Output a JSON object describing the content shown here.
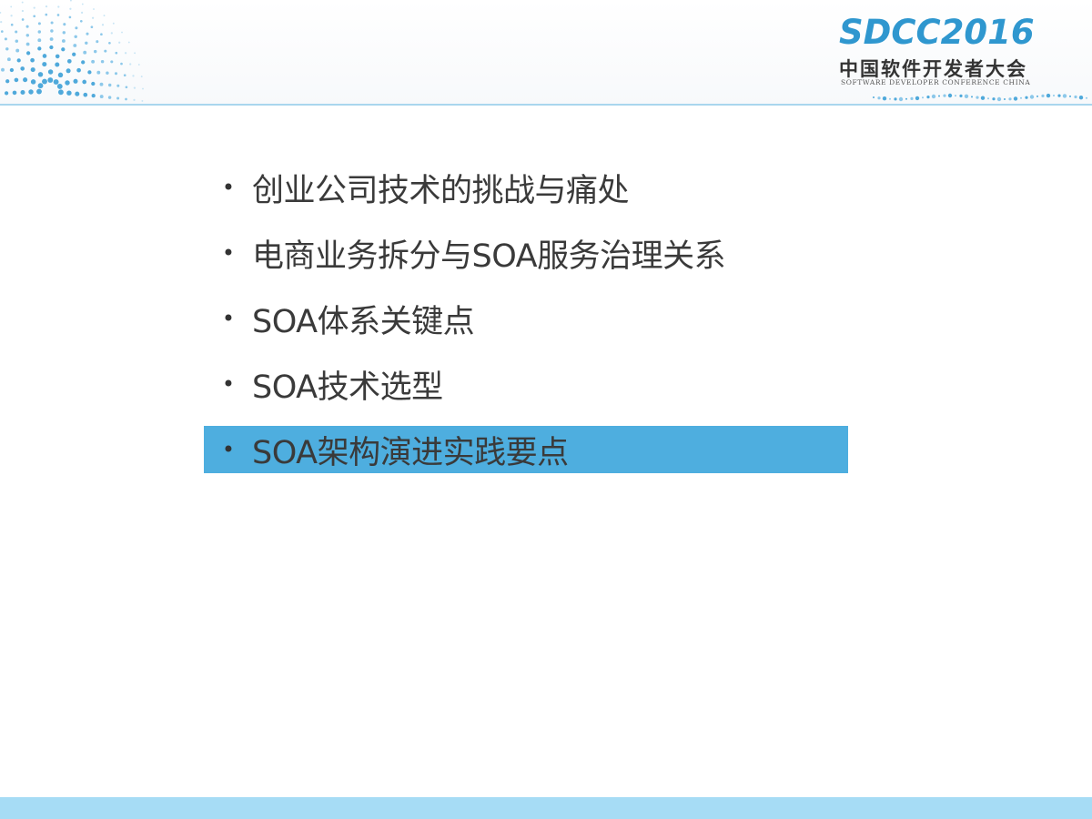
{
  "logo": {
    "title": "SDCC2016",
    "subtitle_cn": "中国软件开发者大会",
    "subtitle_en": "SOFTWARE DEVELOPER CONFERENCE CHINA"
  },
  "agenda": {
    "items": [
      {
        "label": "创业公司技术的挑战与痛处",
        "bullet": "•"
      },
      {
        "label": "电商业务拆分与SOA服务治理关系",
        "bullet": "•"
      },
      {
        "label": "SOA体系关键点",
        "bullet": "•"
      },
      {
        "label": "SOA技术选型",
        "bullet": "•"
      },
      {
        "label": "SOA架构演进实践要点",
        "bullet": "•",
        "highlighted": true
      }
    ]
  },
  "colors": {
    "brand_blue": "#2f97cf",
    "highlight": "#4eaedf",
    "footer": "#a6dcf5",
    "header_line": "#a9d6ee"
  },
  "icons": {
    "header_left": "dotted-arc-decoration",
    "header_right": "dot-cluster-decoration"
  }
}
